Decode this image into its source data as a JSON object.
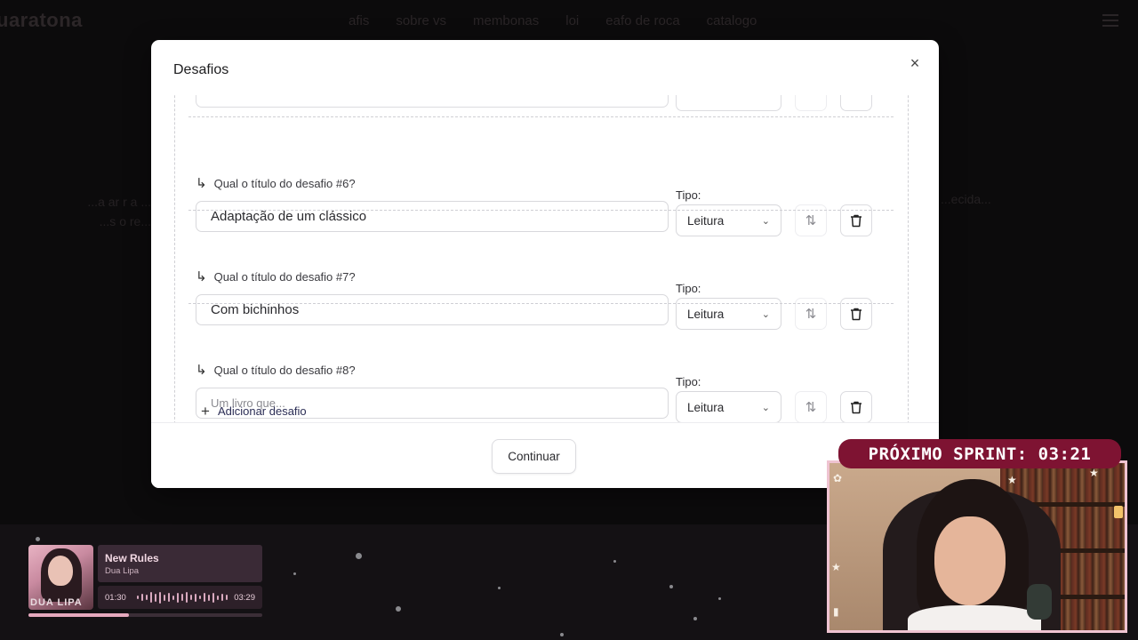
{
  "background": {
    "logo": "uaratona",
    "nav_links": [
      "afis",
      "sobre vs",
      "membonas",
      "loi",
      "eafo de roca",
      "catalogo"
    ],
    "left_text_line1": "...a ar r a ...",
    "left_text_line2": "...s o re...",
    "right_text": "...ecida..."
  },
  "modal": {
    "title": "Desafios",
    "close_label": "×",
    "type_label": "Tipo:",
    "rows": [
      {
        "question": "Qual o título do desafio #6?",
        "value": "Adaptação de um clássico",
        "placeholder": "",
        "type": "Leitura"
      },
      {
        "question": "Qual o título do desafio #7?",
        "value": "Com bichinhos",
        "placeholder": "",
        "type": "Leitura"
      },
      {
        "question": "Qual o título do desafio #8?",
        "value": "",
        "placeholder": "Um livro que...",
        "type": "Leitura"
      }
    ],
    "add_label": "Adicionar desafio",
    "continue_label": "Continuar"
  },
  "player": {
    "song": "New Rules",
    "artist": "Dua Lipa",
    "current_time": "01:30",
    "total_time": "03:29",
    "art_text": "DUA LIPA",
    "progress": 0.43
  },
  "overlay": {
    "sprint_label": "PRÓXIMO SPRINT: 03:21"
  },
  "colors": {
    "sprint_banner": "#7e1332",
    "cam_border": "#efc3d1",
    "accent_link": "#2b2d55"
  }
}
